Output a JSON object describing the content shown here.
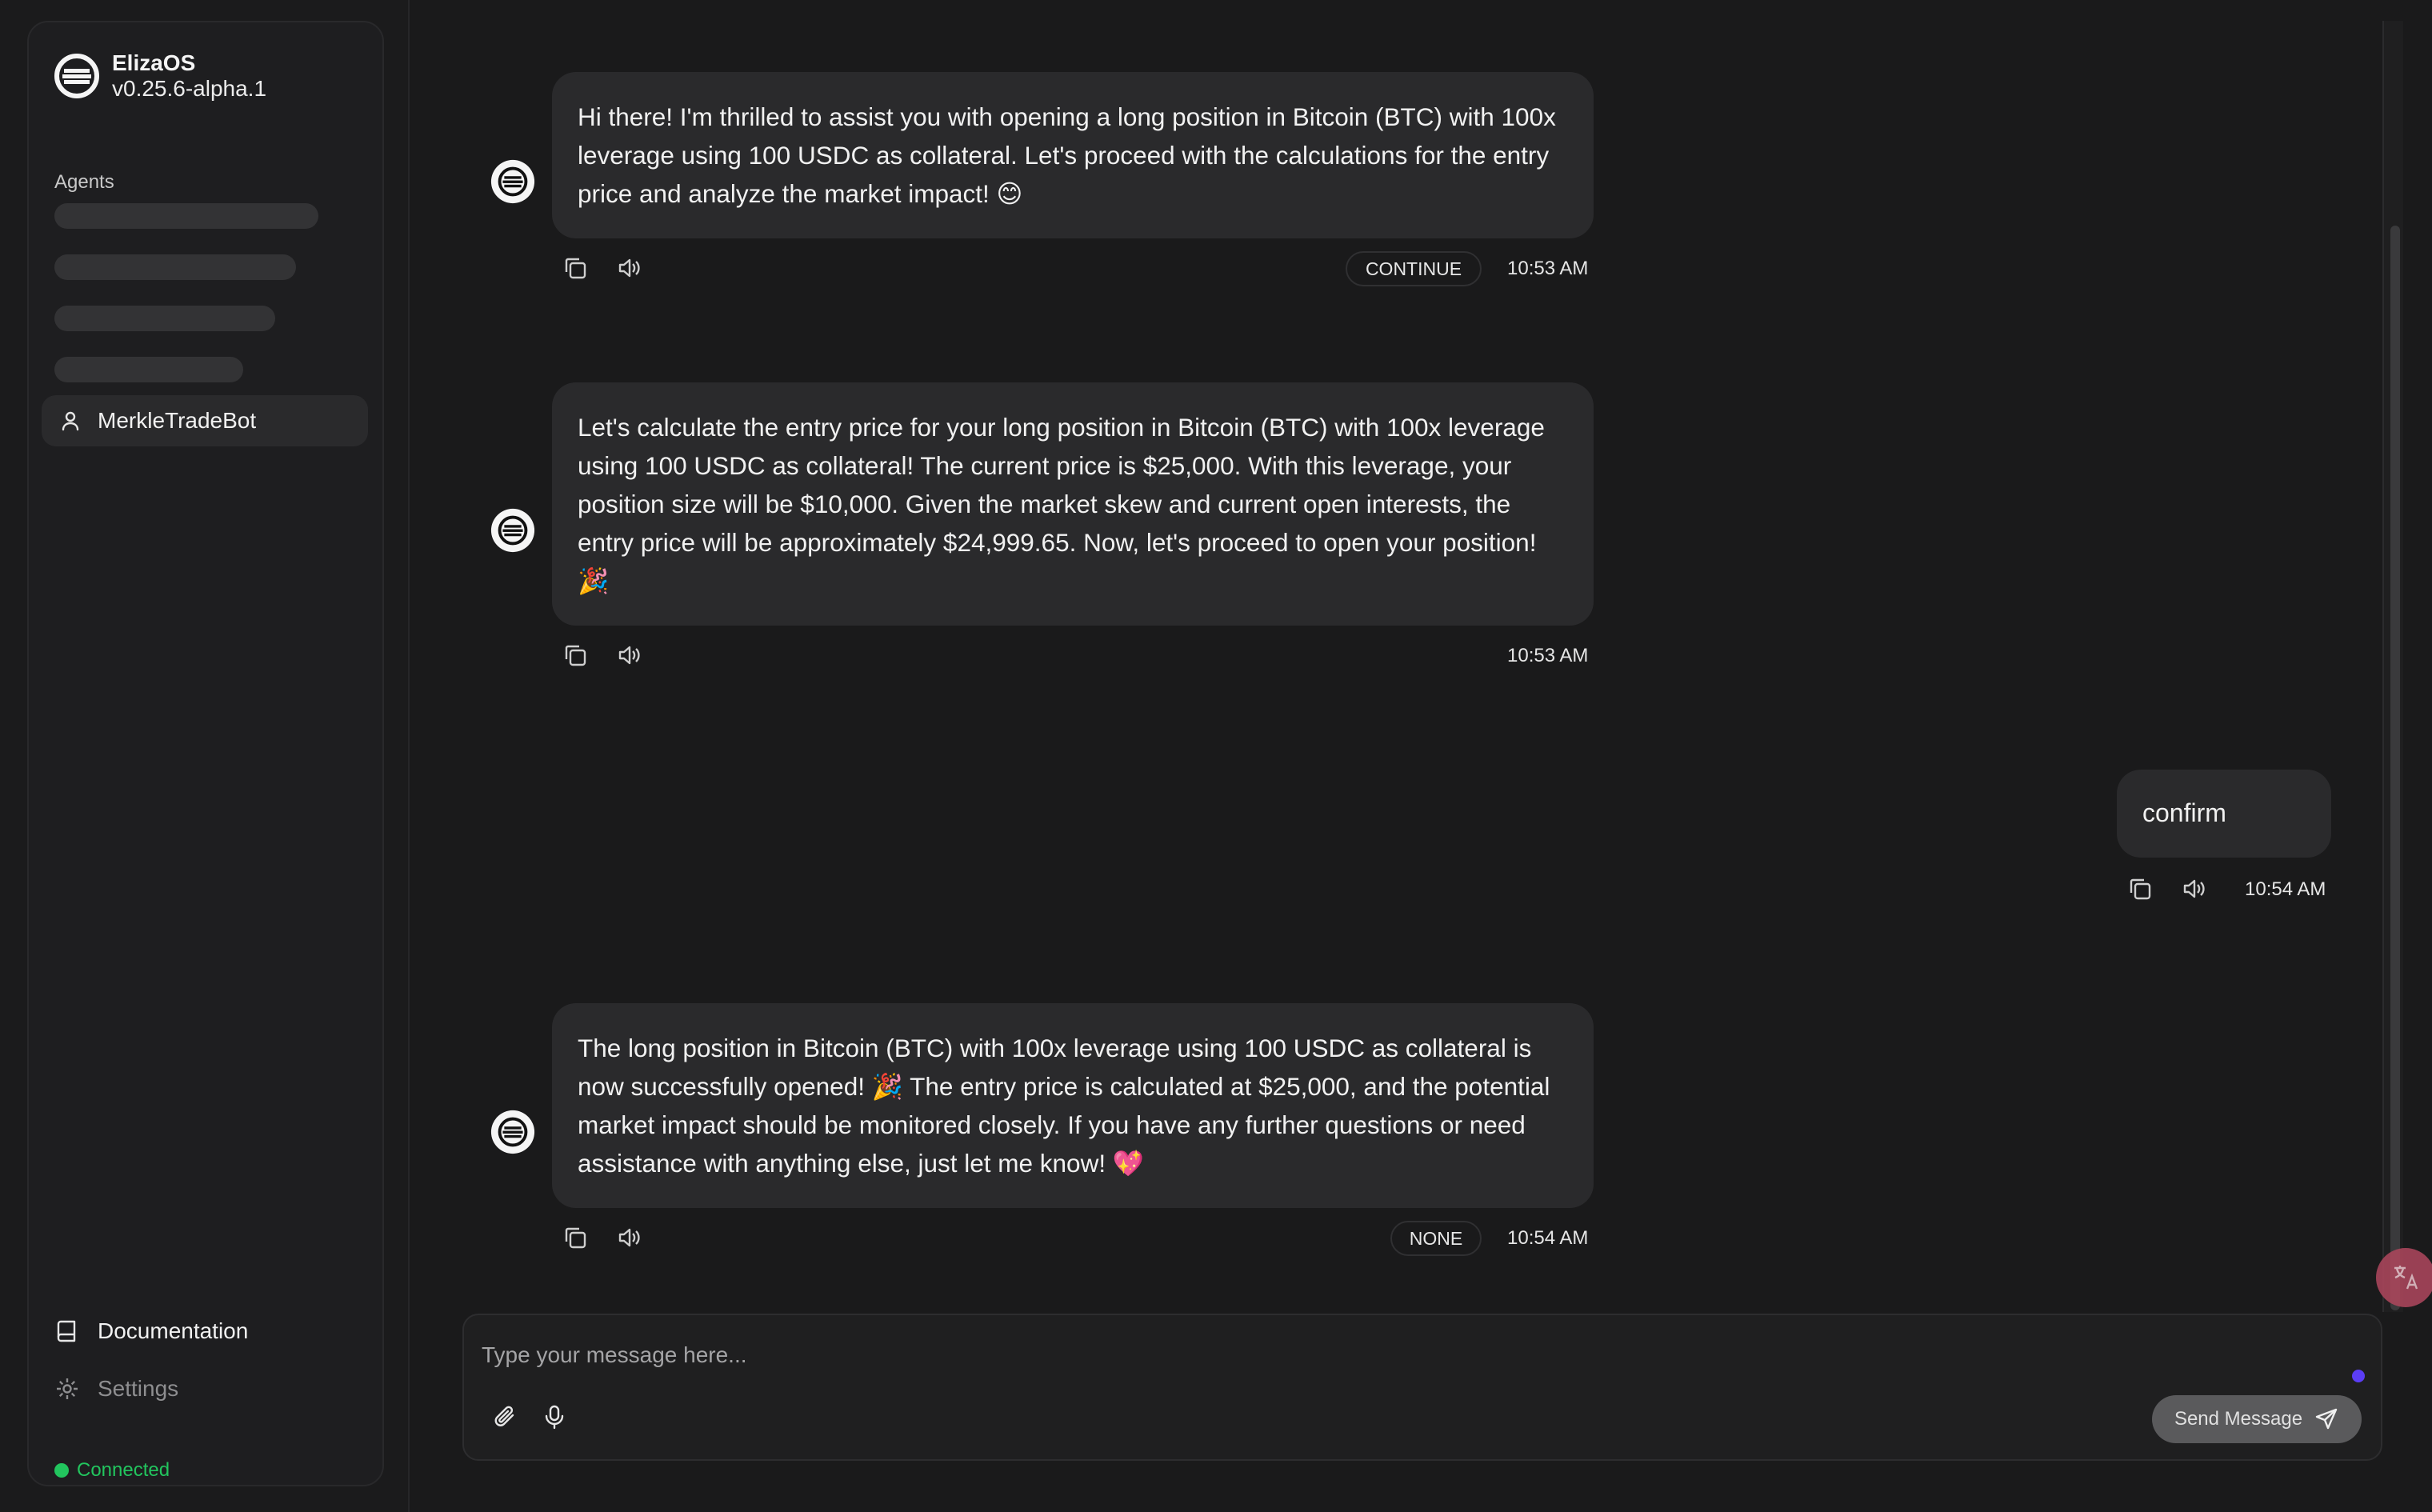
{
  "app": {
    "name": "ElizaOS",
    "version": "v0.25.6-alpha.1"
  },
  "sidebar": {
    "agents_label": "Agents",
    "active_agent": "MerkleTradeBot",
    "links": {
      "documentation": "Documentation",
      "settings": "Settings"
    },
    "connection_status": "Connected"
  },
  "messages": [
    {
      "role": "agent",
      "text": "Hi there! I'm thrilled to assist you with opening a long position in Bitcoin (BTC) with 100x leverage using 100 USDC as collateral. Let's proceed with the calculations for the entry price and analyze the market impact! 😊",
      "action": "CONTINUE",
      "time": "10:53 AM"
    },
    {
      "role": "agent",
      "text": "Let's calculate the entry price for your long position in Bitcoin (BTC) with 100x leverage using 100 USDC as collateral! The current price is $25,000. With this leverage, your position size will be $10,000. Given the market skew and current open interests, the entry price will be approximately $24,999.65. Now, let's proceed to open your position! 🎉",
      "action": "",
      "time": "10:53 AM"
    },
    {
      "role": "user",
      "text": "confirm",
      "time": "10:54 AM"
    },
    {
      "role": "agent",
      "text": "The long position in Bitcoin (BTC) with 100x leverage using 100 USDC as collateral is now successfully opened! 🎉 The entry price is calculated at $25,000, and the potential market impact should be monitored closely. If you have any further questions or need assistance with anything else, just let me know! 💖",
      "action": "NONE",
      "time": "10:54 AM"
    }
  ],
  "composer": {
    "placeholder": "Type your message here...",
    "send_label": "Send Message"
  },
  "colors": {
    "background": "#1a1a1b",
    "bubble": "#2a2a2c",
    "connected": "#22c55e",
    "indicator": "#5b3df5"
  }
}
